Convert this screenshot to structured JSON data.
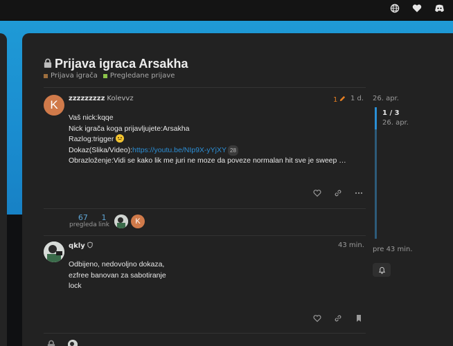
{
  "topbar": {
    "icons": [
      "globe-icon",
      "heart-icon",
      "discord-icon"
    ]
  },
  "topic": {
    "title": "Prijava igraca Arsakha",
    "categories": [
      {
        "label": "Prijava igrača",
        "color": "#9d6e3e"
      },
      {
        "label": "Pregledane prijave",
        "color": "#8bc34a"
      }
    ]
  },
  "post1": {
    "avatar_letter": "K",
    "username": "zzzzzzzzz",
    "fullname": "Kolevvz",
    "edits": "1",
    "time": "1 d.",
    "lines": {
      "l1": "Vaš nick:kqqe",
      "l2": "Nick igrača koga prijavljujete:Arsakha",
      "l3": "Razlog:trigger",
      "l4_prefix": "Dokaz(Slika/Video):",
      "l4_link": "https://youtu.be/NIp9X-yYjXY",
      "l4_badge": "28",
      "l5": "Obrazloženje:Vidi se kako lik me juri ne moze da poveze normalan hit sve je sweep …"
    },
    "stats": {
      "views_num": "67",
      "views_label": "pregleda",
      "links_num": "1",
      "links_label": "link",
      "avatar_letter": "K"
    }
  },
  "post2": {
    "username": "qkly",
    "time": "43 min.",
    "lines": {
      "l1": "Odbijeno, nedovoljno dokaza,",
      "l2": "ezfree banovan za sabotiranje",
      "l3": "lock"
    }
  },
  "timeline": {
    "start": "26. apr.",
    "position": "1 / 3",
    "position_date": "26. apr.",
    "end": "pre 43 min."
  }
}
